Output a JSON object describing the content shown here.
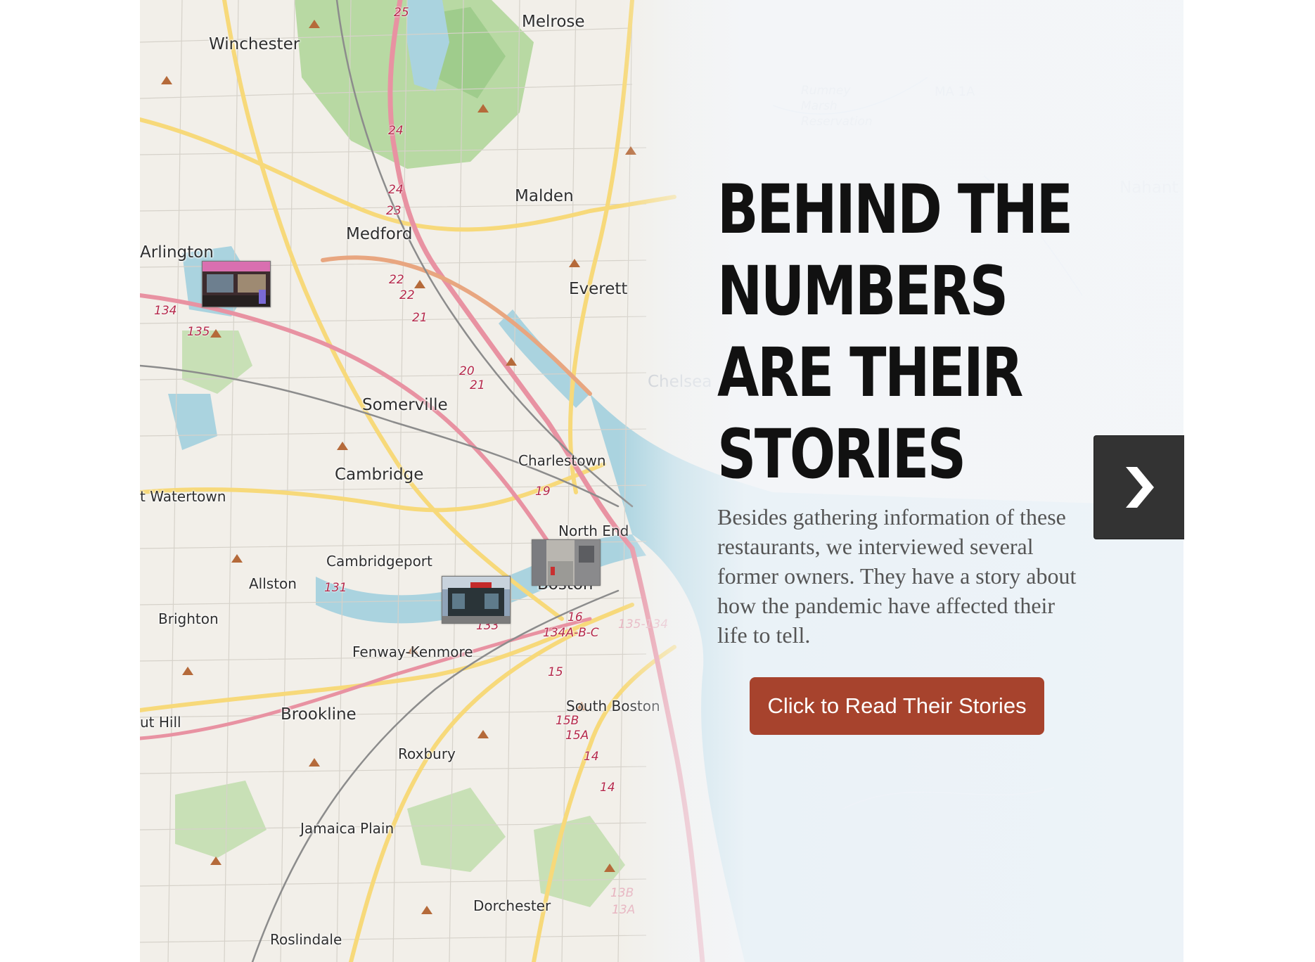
{
  "headline": "BEHIND THE\nNUMBERS\nARE THEIR\nSTORIES",
  "lede": "Besides gathering information of these restaurants, we interviewed several former owners. They have a story about how the pandemic have affected their life to tell.",
  "cta_label": "Click to Read Their Stories",
  "next_icon": "chevron-right-icon",
  "colors": {
    "cta": "#a7432d",
    "next": "#333333",
    "headline": "#111111",
    "lede": "#555555"
  },
  "map": {
    "places": [
      "Winchester",
      "Melrose",
      "Malden",
      "Medford",
      "Arlington",
      "Everett",
      "Somerville",
      "Chelsea",
      "Charlestown",
      "Cambridge",
      "t Watertown",
      "North End",
      "Cambridgeport",
      "Allston",
      "Boston",
      "Brighton",
      "Fenway-Kenmore",
      "South Boston",
      "Brookline",
      "ut Hill",
      "Roxbury",
      "Jamaica Plain",
      "Dorchester",
      "Roslindale",
      "Nahant",
      "Rumney Marsh Reservation",
      "MA 1A"
    ],
    "routes": [
      "25",
      "24",
      "24",
      "23",
      "22",
      "22",
      "21",
      "20",
      "21",
      "134",
      "135",
      "19",
      "131",
      "133",
      "16",
      "134A-B-C",
      "135-134",
      "15",
      "15B",
      "15A",
      "14",
      "14",
      "13B",
      "13A"
    ]
  }
}
